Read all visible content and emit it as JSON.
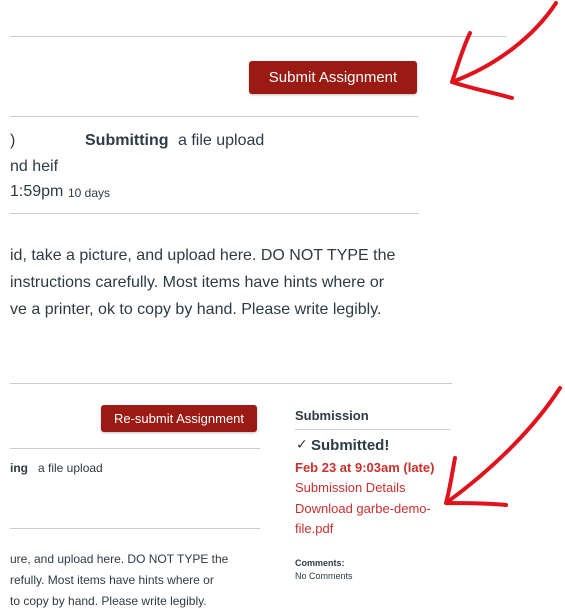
{
  "top": {
    "submit_label": "Submit Assignment",
    "points_fragment": ")",
    "submitting_label": "Submitting",
    "submitting_type": "a file upload",
    "file_types_fragment": "nd heif",
    "due_fragment": "1:59pm",
    "due_relative": "10 days",
    "desc_line1": "id, take a picture, and upload here. DO NOT TYPE the",
    "desc_line2": "instructions carefully. Most items have hints where or",
    "desc_line3": "ve a printer, ok to copy by hand. Please write legibly."
  },
  "bottom": {
    "resubmit_label": "Re-submit Assignment",
    "submitting_label": "ing",
    "submitting_type": "a file upload",
    "desc_line1": "ure, and upload here. DO NOT TYPE the",
    "desc_line2": "refully. Most items have hints where or",
    "desc_line3": "to copy by hand. Please write legibly."
  },
  "submission": {
    "heading": "Submission",
    "check_glyph": "✓",
    "status": "Submitted!",
    "date": "Feb 23 at 9:03am (late)",
    "details_link": "Submission Details",
    "download_line1": "Download garbe-demo-",
    "download_line2": "file.pdf",
    "comments_label": "Comments:",
    "comments_value": "No Comments"
  },
  "colors": {
    "button": "#9b1b14",
    "late": "#c9302c",
    "annotation": "#e0121b"
  }
}
